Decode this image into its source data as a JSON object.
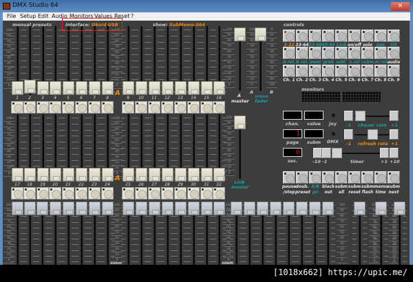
{
  "window": {
    "title": "DMX Studio 64",
    "close_icon": "close-icon"
  },
  "menu": [
    "File",
    "Setup",
    "Edit",
    "Audio",
    "Monitors",
    "Values",
    "Reset",
    "?"
  ],
  "header": {
    "manual_presets": "manual presets",
    "interface_label": "interface:",
    "interface_value": "Oksrd USB",
    "show_label": "show:",
    "show_value": "SubMemo.064",
    "controls": "controls",
    "monitors": "monitors"
  },
  "scale_labels": [
    "100",
    "90",
    "80",
    "70",
    "60",
    "50",
    "40",
    "30",
    "20",
    "10",
    "0"
  ],
  "scale_labels_reverse": [
    "0",
    "10",
    "20",
    "30",
    "40",
    "50",
    "60",
    "70",
    "80",
    "90",
    "100"
  ],
  "presets": {
    "row1_channels": [
      "1",
      "2",
      "3",
      "4",
      "5",
      "6",
      "7",
      "8",
      "9",
      "10",
      "11",
      "12",
      "13",
      "14",
      "15",
      "16"
    ],
    "row2_channels": [
      "17",
      "18",
      "19",
      "20",
      "21",
      "22",
      "23",
      "24",
      "25",
      "26",
      "27",
      "28",
      "29",
      "30",
      "31",
      "32"
    ],
    "row1_values": [
      0,
      3,
      0,
      0,
      0,
      0,
      0,
      0,
      0,
      0,
      0,
      0,
      0,
      0,
      0,
      0
    ],
    "row2_values": [
      0,
      0,
      0,
      0,
      0,
      0,
      0,
      0,
      0,
      0,
      0,
      0,
      0,
      0,
      0,
      0
    ],
    "bank_marker": "A"
  },
  "masters": {
    "a_master": {
      "label1": "A",
      "label2": "master",
      "value": 100
    },
    "cross_fader": {
      "label": "cross fader",
      "end_a": "A",
      "end_b": "B",
      "value": 0
    },
    "link_master": {
      "label": "Link master",
      "value": 100
    }
  },
  "submasters": {
    "label": "subm",
    "values": [
      100,
      100,
      100,
      100,
      100,
      100,
      100,
      100,
      100,
      100,
      100,
      100,
      100,
      100,
      100,
      100,
      100,
      100,
      100,
      100,
      100,
      100,
      100,
      100,
      100,
      100,
      100
    ]
  },
  "controls": {
    "row1": [
      {
        "t": "1-32",
        "c": "orange",
        "active": true
      },
      {
        "t": "33-64",
        "c": "white"
      },
      {
        "t": "33-48",
        "c": "teal"
      },
      {
        "t": "49-64",
        "c": "teal"
      },
      {
        "t": "Link",
        "c": "teal"
      },
      {
        "t": "on/off",
        "c": "white"
      },
      {
        "t": "solo",
        "c": "white"
      },
      {
        "t": "pan",
        "c": "teal"
      },
      {
        "t": "tilt",
        "c": "teal"
      }
    ],
    "row2": [
      {
        "t": "A rel.",
        "c": "teal"
      },
      {
        "t": "B rel.",
        "c": "teal"
      },
      {
        "t": "mem",
        "c": "teal"
      },
      {
        "t": "grab",
        "c": "teal"
      },
      {
        "t": "add.",
        "c": "teal"
      },
      {
        "t": "s.rel",
        "c": "teal"
      },
      {
        "t": "subm",
        "c": "teal"
      },
      {
        "t": "m.rel",
        "c": "teal"
      },
      {
        "t": "audio",
        "c": "white"
      }
    ],
    "row3": [
      {
        "t": "Ch. 1",
        "c": "white"
      },
      {
        "t": "Ch. 2",
        "c": "white"
      },
      {
        "t": "Ch. 3",
        "c": "white"
      },
      {
        "t": "Ch. 4",
        "c": "white"
      },
      {
        "t": "Ch. 5",
        "c": "white"
      },
      {
        "t": "Ch. 6",
        "c": "white"
      },
      {
        "t": "Ch. 7",
        "c": "white"
      },
      {
        "t": "Ch. 8",
        "c": "white"
      },
      {
        "t": "Ch. 9",
        "c": "white"
      }
    ]
  },
  "displays": {
    "chan": {
      "label": "chan.",
      "value": ""
    },
    "value": {
      "label": "value",
      "value": ""
    },
    "page": {
      "label": "page",
      "value": "1"
    },
    "subm": {
      "label": "subm",
      "value": ""
    },
    "sec": {
      "label": "sec.",
      "value": "0"
    },
    "joy": "joy",
    "dmx": "DMX"
  },
  "chaser_rate": {
    "label": "chaser rate",
    "minus": "-1",
    "plus": "+1"
  },
  "refresh_rate": {
    "label": "refresh rate",
    "minus": "-1",
    "plus": "+1"
  },
  "timer": {
    "label": "timer",
    "m10": "-10",
    "m1": "-1",
    "p1": "+1",
    "p10": "+10"
  },
  "bottom_controls": [
    {
      "l1": "pause",
      "l2": "/stop",
      "c": "white"
    },
    {
      "l1": "doub.",
      "l2": "preset",
      "c": "white"
    },
    {
      "l1": "A/B",
      "l2": "go",
      "c": "teal"
    },
    {
      "l1": "black",
      "l2": "out",
      "c": "white"
    },
    {
      "l1": "subm",
      "l2": "all",
      "c": "white"
    },
    {
      "l1": "subm",
      "l2": "reset",
      "c": "white"
    },
    {
      "l1": "subm",
      "l2": "flash",
      "c": "white"
    },
    {
      "l1": "memo",
      "l2": "time",
      "c": "white"
    },
    {
      "l1": "subm",
      "l2": "next",
      "c": "white"
    }
  ],
  "watermark": "[1018x662] https://upic.me/",
  "colors": {
    "panel": "#3d3d3d",
    "accent_orange": "#f08a10",
    "accent_teal": "#1aa0a0",
    "titlebar": "#5f8fc4"
  }
}
